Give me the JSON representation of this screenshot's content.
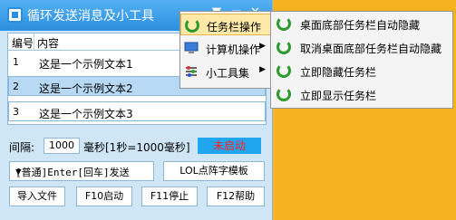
{
  "window": {
    "title": "循环发送消息及小工具",
    "controls": [
      "▼",
      "－",
      "✕"
    ]
  },
  "list": {
    "headers": {
      "num": "编号",
      "content": "内容"
    },
    "rows": [
      {
        "num": "1",
        "text": "这是一个示例文本1"
      },
      {
        "num": "2",
        "text": "这是一个示例文本2"
      },
      {
        "num": "3",
        "text": "这是一个示例文本3"
      }
    ]
  },
  "controls": {
    "interval_label": "间隔:",
    "interval_value": "1000",
    "interval_unit": "毫秒[1秒=1000毫秒]",
    "status": "未启动",
    "send_mode": "[普通]Enter[回车]发送",
    "lol_button": "LOL点阵字模板",
    "import_button": "导入文件",
    "f10_button": "F10启动",
    "f11_button": "F11停止",
    "f12_button": "F12帮助"
  },
  "menu": {
    "items": [
      {
        "label": "任务栏操作",
        "arrow": "▶"
      },
      {
        "label": "计算机操作",
        "arrow": "▶"
      },
      {
        "label": "小工具集",
        "arrow": "▶"
      }
    ]
  },
  "submenu": {
    "items": [
      {
        "label": "桌面底部任务栏自动隐藏"
      },
      {
        "label": "取消桌面底部任务栏自动隐藏"
      },
      {
        "label": "立即隐藏任务栏"
      },
      {
        "label": "立即显示任务栏"
      }
    ]
  },
  "colors": {
    "desktop": "#f6b21f",
    "titlebar": "#2a8fe0",
    "status_text": "#ff2020",
    "menu_highlight": "#ffe9a8"
  }
}
